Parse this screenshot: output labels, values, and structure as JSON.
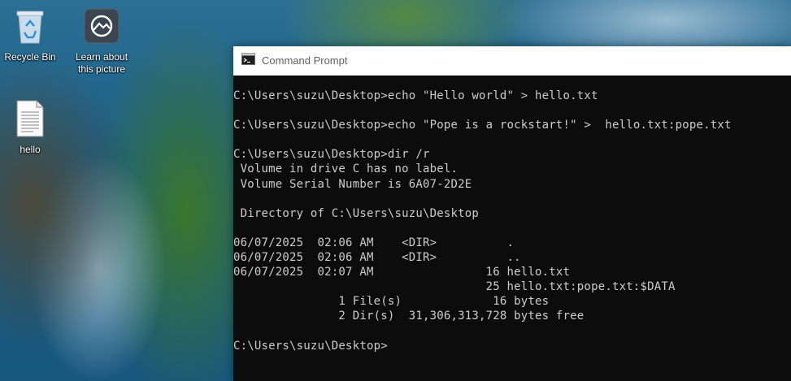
{
  "desktop": {
    "icons": [
      {
        "label": "Recycle Bin",
        "icon": "recycle-bin-icon"
      },
      {
        "label": "Learn about this picture",
        "line1": "Learn about",
        "line2": "this picture",
        "icon": "learn-about-picture-icon"
      },
      {
        "label": "hello",
        "icon": "text-file-icon"
      }
    ]
  },
  "window": {
    "title": "Command Prompt",
    "icon": "command-prompt-icon"
  },
  "console": {
    "lines": [
      "C:\\Users\\suzu\\Desktop>echo \"Hello world\" > hello.txt",
      "",
      "C:\\Users\\suzu\\Desktop>echo \"Pope is a rockstart!\" >  hello.txt:pope.txt",
      "",
      "C:\\Users\\suzu\\Desktop>dir /r",
      " Volume in drive C has no label.",
      " Volume Serial Number is 6A07-2D2E",
      "",
      " Directory of C:\\Users\\suzu\\Desktop",
      "",
      "06/07/2025  02:06 AM    <DIR>          .",
      "06/07/2025  02:06 AM    <DIR>          ..",
      "06/07/2025  02:07 AM                16 hello.txt",
      "                                    25 hello.txt:pope.txt:$DATA",
      "               1 File(s)             16 bytes",
      "               2 Dir(s)  31,306,313,728 bytes free",
      "",
      "C:\\Users\\suzu\\Desktop>"
    ]
  }
}
